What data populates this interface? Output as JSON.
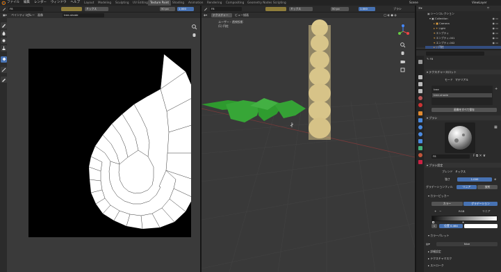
{
  "topbar": {
    "menus": [
      "ファイル",
      "編集",
      "レンダー",
      "ウィンドウ",
      "ヘルプ"
    ],
    "workspaces": [
      "Layout",
      "Modeling",
      "Sculpting",
      "UV Editing",
      "Texture Paint",
      "Shading",
      "Animation",
      "Rendering",
      "Compositing",
      "Geometry Nodes",
      "Scripting"
    ],
    "active_workspace": "Texture Paint",
    "scene": "Scene",
    "view_layer": "ViewLayer"
  },
  "image_editor": {
    "brush_name": "F8",
    "blend": "ミックス",
    "radius": "半径",
    "radius_value": "50 px",
    "strength_value": "1.000",
    "menus": [
      "ペインティング",
      "ビュー",
      "画像"
    ],
    "image_name": "tree-shade"
  },
  "viewport": {
    "mode": "テクスチャー",
    "brush_name": "F8",
    "blend": "ミックス",
    "radius_value": "50 px",
    "strength_value": "1.000",
    "menus": [
      "ビュー",
      "描画"
    ],
    "view_name": "ユーザー・透視投影",
    "object_name": "(1) 円柱",
    "brushes_label": "ブラシ"
  },
  "outliner": {
    "title": "シーンコレクション",
    "rows": [
      {
        "label": "Collection",
        "indent": 1
      },
      {
        "label": "Camera",
        "indent": 2
      },
      {
        "label": "Light",
        "indent": 2
      },
      {
        "label": "エンプティ",
        "indent": 2
      },
      {
        "label": "エンプティ.001",
        "indent": 2
      },
      {
        "label": "エンプティ.002",
        "indent": 2
      },
      {
        "label": "円柱",
        "indent": 2,
        "selected": true
      }
    ]
  },
  "properties": {
    "object_name": "F8",
    "texture_slots_title": "テクスチャースロット",
    "mode_label": "モード",
    "mode_value": "マテリアル",
    "slots": [
      "tree",
      "tree-shade"
    ],
    "save_all_button": "画像をすべて保存",
    "brush_section": "ブラシ",
    "brush_name": "F8",
    "brush_settings_section": "ブラシ設定",
    "blend_label": "ブレンド",
    "blend_value": "ミックス",
    "strength_label": "強さ",
    "strength_value": "1.000",
    "gradient_fill_label": "グラデーションフィル",
    "linear_btn": "リニア",
    "radial_btn": "放射",
    "color_picker_section": "カラーピッカー",
    "color_tab": "カラー",
    "gradient_tab": "グラデーション",
    "rgb_label": "RGB",
    "linear_label": "リニア",
    "stop_index": "1",
    "stop_pos_label": "位置",
    "stop_pos_value": "0.464",
    "color_palette_section": "カラーパレット",
    "palette_value": "Nice",
    "advanced_section": "詳細設定",
    "texture_mask_section": "テクスチャマスク",
    "stroke_section": "ストローク"
  },
  "colors": {
    "accent_blue": "#4772b3",
    "leaf_green": "#2e9a2e",
    "trunk_tan": "#d8c58a",
    "background": "#303030"
  }
}
